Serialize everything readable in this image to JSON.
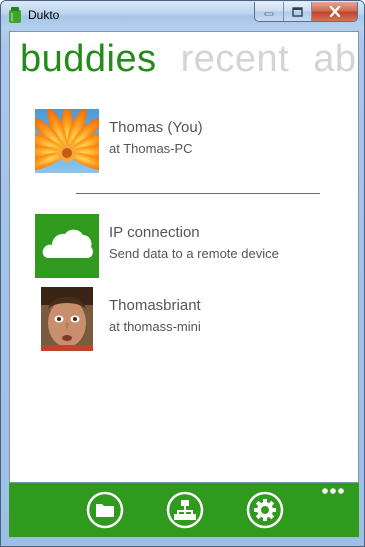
{
  "window": {
    "title": "Dukto"
  },
  "tabs": [
    {
      "label": "buddies"
    },
    {
      "label": "recent"
    },
    {
      "label": "ab"
    }
  ],
  "buddies": [
    {
      "name": "Thomas (You)",
      "subtitle": "at Thomas-PC",
      "avatar": "orange-gerbera-flower-photo"
    },
    {
      "name": "IP connection",
      "subtitle": "Send data to a remote device",
      "avatar": "cloud-icon"
    },
    {
      "name": "Thomasbriant",
      "subtitle": "at thomass-mini",
      "avatar": "face-photo"
    }
  ],
  "toolbar": {
    "buttons": [
      "folder-icon",
      "network-icon",
      "gear-icon"
    ],
    "more": "more-dots-icon"
  },
  "colors": {
    "accent": "#248b1a",
    "bar": "#2f9a1e",
    "tab_inactive": "#d4d4d4",
    "text": "#555555"
  }
}
